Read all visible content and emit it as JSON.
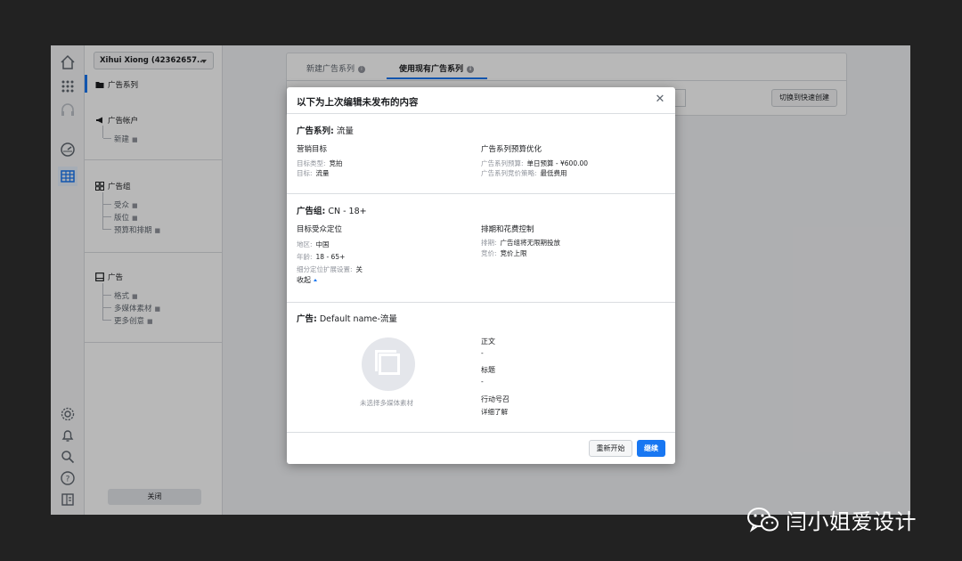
{
  "nav": {
    "account_selector": "Xihui Xiong (42362657...",
    "campaign": "广告系列",
    "ad_account": "广告帐户",
    "new": "新建",
    "ad_set": "广告组",
    "ad_set_items": [
      "受众",
      "版位",
      "预算和排期"
    ],
    "ad": "广告",
    "ad_items": [
      "格式",
      "多媒体素材",
      "更多创意"
    ],
    "close": "关闭"
  },
  "tabs": [
    {
      "label": "新建广告系列"
    },
    {
      "label": "使用现有广告系列"
    }
  ],
  "quick_create": "切换到快速创建",
  "modal": {
    "title": "以下为上次编辑未发布的内容",
    "campaign_section": {
      "label": "广告系列:",
      "value": "流量",
      "objective_heading": "营销目标",
      "buy_type_label": "目标类型:",
      "buy_type_value": "竞拍",
      "objective_label": "目标:",
      "objective_value": "流量",
      "budget_heading": "广告系列预算优化",
      "budget_label": "广告系列预算:",
      "budget_value": "单日预算 - ¥600.00",
      "bid_label": "广告系列竞价策略:",
      "bid_value": "最低费用"
    },
    "adset_section": {
      "label": "广告组:",
      "value": "CN - 18+",
      "audience_heading": "目标受众定位",
      "location_label": "地区:",
      "location_value": "中国",
      "age_label": "年龄:",
      "age_value": "18 - 65+",
      "expansion_label": "细分定位扩展设置:",
      "expansion_value": "关",
      "collapse": "收起",
      "schedule_heading": "排期和花费控制",
      "schedule_label": "排期:",
      "schedule_value": "广告组将无限期投放",
      "bid_label": "竞价:",
      "bid_value": "竞价上限"
    },
    "ad_section": {
      "label": "广告:",
      "value": "Default name-流量",
      "media_caption": "未选择多媒体素材",
      "primary_text_label": "正文",
      "primary_text_value": "-",
      "headline_label": "标题",
      "headline_value": "-",
      "cta_label": "行动号召",
      "cta_value": "详细了解"
    },
    "restart_button": "重新开始",
    "continue_button": "继续"
  },
  "watermark": "闫小姐爱设计",
  "colors": {
    "accent": "#1877f2",
    "backdrop": "#222222",
    "overlay": "rgba(0,0,0,0.28)"
  }
}
